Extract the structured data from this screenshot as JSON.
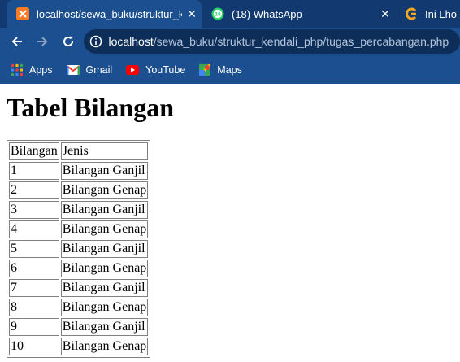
{
  "browser": {
    "tabs": [
      {
        "title": "localhost/sewa_buku/struktur_kendali_php/tugas_percabangan.php",
        "active": true
      },
      {
        "title": "(18) WhatsApp",
        "active": false,
        "badge": "18"
      },
      {
        "title": "Ini Lho C",
        "active": false
      }
    ],
    "close_glyph": "✕",
    "url_host": "localhost",
    "url_path": "/sewa_buku/struktur_kendali_php/tugas_percabangan.php",
    "bookmarks": [
      {
        "label": "Apps",
        "icon": "apps-grid-icon"
      },
      {
        "label": "Gmail",
        "icon": "gmail-icon"
      },
      {
        "label": "YouTube",
        "icon": "youtube-icon"
      },
      {
        "label": "Maps",
        "icon": "maps-icon"
      }
    ],
    "colors": {
      "frame": "#123a70",
      "toolbar": "#1b4f8f",
      "omnibox": "#0e2e5a"
    }
  },
  "page": {
    "heading": "Tabel Bilangan",
    "table": {
      "headers": [
        "Bilangan",
        "Jenis"
      ],
      "rows": [
        [
          "1",
          "Bilangan Ganjil"
        ],
        [
          "2",
          "Bilangan Genap"
        ],
        [
          "3",
          "Bilangan Ganjil"
        ],
        [
          "4",
          "Bilangan Genap"
        ],
        [
          "5",
          "Bilangan Ganjil"
        ],
        [
          "6",
          "Bilangan Genap"
        ],
        [
          "7",
          "Bilangan Ganjil"
        ],
        [
          "8",
          "Bilangan Genap"
        ],
        [
          "9",
          "Bilangan Ganjil"
        ],
        [
          "10",
          "Bilangan Genap"
        ]
      ]
    }
  }
}
